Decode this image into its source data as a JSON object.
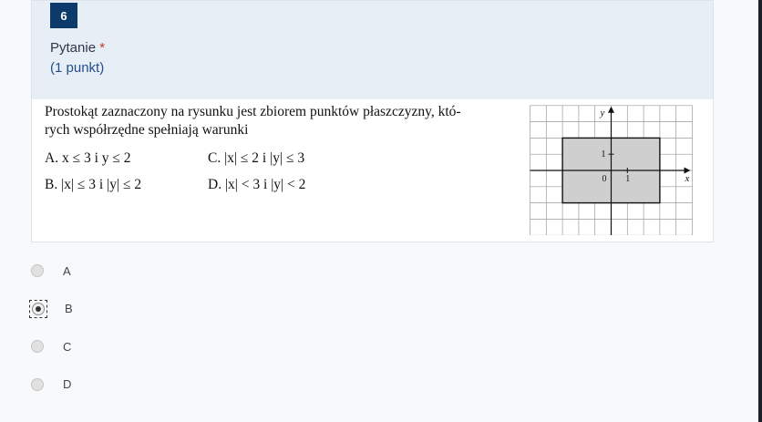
{
  "question": {
    "number": "6",
    "label": "Pytanie",
    "required_mark": "*",
    "points": "(1 punkt)",
    "statement_line1": "Prostokąt zaznaczony na rysunku jest zbiorem punktów płaszczyzny, któ-",
    "statement_line2": "rych współrzędne spełniają warunki",
    "options": {
      "a": "A.  x ≤ 3  i  y ≤ 2",
      "b": "B.  |x| ≤ 3  i  |y| ≤ 2",
      "c": "C.  |x| ≤ 2  i  |y| ≤ 3",
      "d": "D.  |x| < 3  i  |y| < 2"
    },
    "figure": {
      "y_axis_label": "y",
      "x_axis_label": "x",
      "tick_one_y": "1",
      "tick_one_x": "1",
      "origin_label": "0",
      "rectangle": {
        "x_min": -3,
        "x_max": 3,
        "y_min": -2,
        "y_max": 2
      },
      "grid_x_range": [
        -5,
        5
      ],
      "grid_y_range": [
        -4,
        4
      ],
      "fill_color": "#cfcfcf"
    }
  },
  "answers": [
    {
      "label": "A",
      "selected": false
    },
    {
      "label": "B",
      "selected": true
    },
    {
      "label": "C",
      "selected": false
    },
    {
      "label": "D",
      "selected": false
    }
  ],
  "colors": {
    "header_bg": "#e8eef6",
    "badge_bg": "#0b3a6b",
    "required": "#c0392b",
    "points_text": "#1f4e8c"
  }
}
